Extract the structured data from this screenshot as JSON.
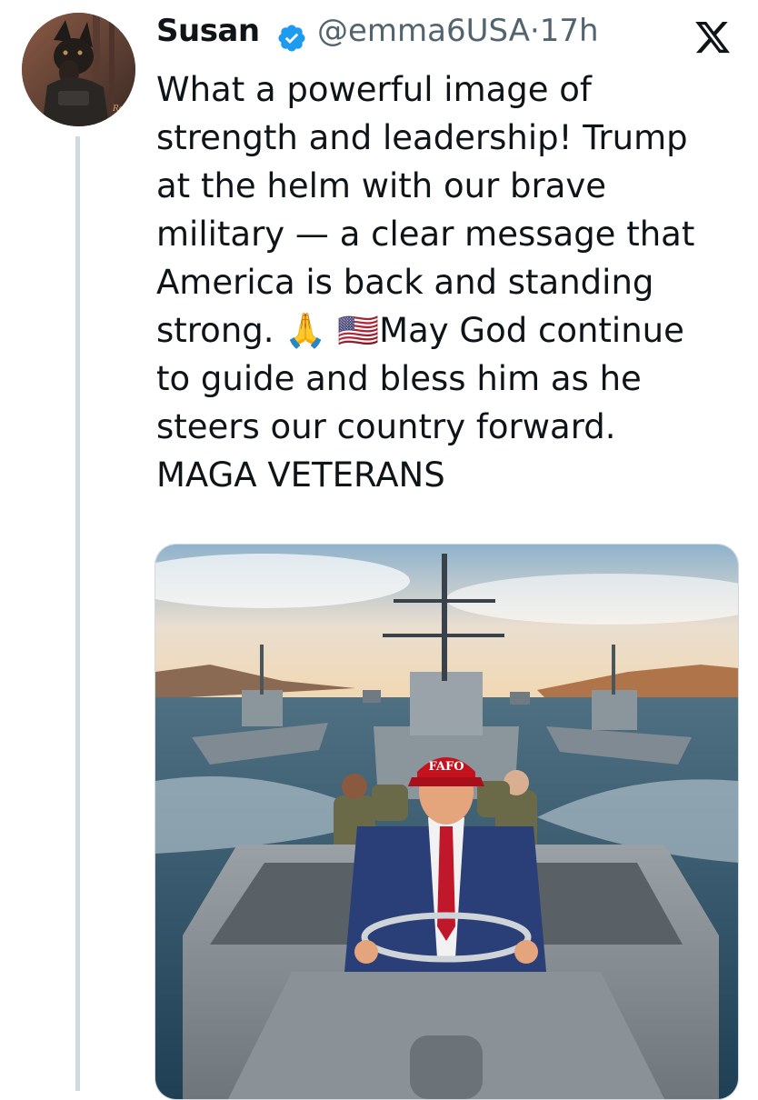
{
  "tweet": {
    "author_name": "Susan",
    "handle": "@emma6USA",
    "separator": "·",
    "time": "17h",
    "text": "What a powerful image of\nstrength and leadership!  Trump\nat the helm with our brave\nmilitary — a clear message that\nAmerica is back and standing\nstrong.  🙏 🇺🇸May God continue\nto guide and bless him as he\nsteers our country forward.\nMAGA VETERANS"
  },
  "media": {
    "cap_text": "FAFO"
  },
  "icons": {
    "verified": "verified-badge-icon",
    "platform": "x-logo-icon"
  },
  "colors": {
    "verified_blue": "#1d9bf0",
    "secondary_text": "#536471",
    "thread_line": "#cfd9de"
  }
}
